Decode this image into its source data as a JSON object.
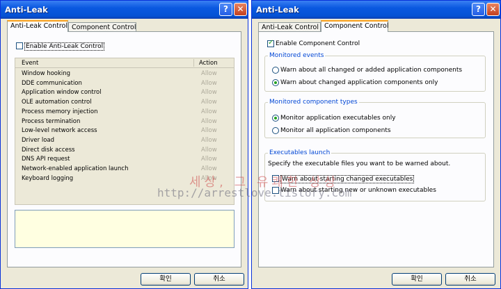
{
  "left_window": {
    "title": "Anti-Leak",
    "tabs": [
      {
        "label": "Anti-Leak Control"
      },
      {
        "label": "Component Control"
      }
    ],
    "enable_label": "Enable Anti-Leak Control",
    "enable_checked": false,
    "table": {
      "headers": {
        "event": "Event",
        "action": "Action"
      },
      "rows": [
        {
          "event": "Window hooking",
          "action": "Allow"
        },
        {
          "event": "DDE communication",
          "action": "Allow"
        },
        {
          "event": "Application window control",
          "action": "Allow"
        },
        {
          "event": "OLE automation control",
          "action": "Allow"
        },
        {
          "event": "Process memory injection",
          "action": "Allow"
        },
        {
          "event": "Process termination",
          "action": "Allow"
        },
        {
          "event": "Low-level network access",
          "action": "Allow"
        },
        {
          "event": "Driver load",
          "action": "Allow"
        },
        {
          "event": "Direct disk access",
          "action": "Allow"
        },
        {
          "event": "DNS API request",
          "action": "Allow"
        },
        {
          "event": "Network-enabled application launch",
          "action": "Allow"
        },
        {
          "event": "Keyboard logging",
          "action": "Allow"
        }
      ]
    },
    "ok_label": "확인",
    "cancel_label": "취소"
  },
  "right_window": {
    "title": "Anti-Leak",
    "tabs": [
      {
        "label": "Anti-Leak Control"
      },
      {
        "label": "Component Control"
      }
    ],
    "enable_label": "Enable Component Control",
    "enable_checked": true,
    "monitored_events": {
      "title": "Monitored events",
      "options": [
        {
          "label": "Warn about all changed or added application components",
          "selected": false
        },
        {
          "label": "Warn about changed application components only",
          "selected": true
        }
      ]
    },
    "monitored_types": {
      "title": "Monitored component types",
      "options": [
        {
          "label": "Monitor application executables only",
          "selected": true
        },
        {
          "label": "Monitor all application components",
          "selected": false
        }
      ]
    },
    "executables_launch": {
      "title": "Executables launch",
      "description": "Specify the executable files you want to be warned about.",
      "options": [
        {
          "label": "Warn about starting changed executables",
          "checked": false
        },
        {
          "label": "Warn about starting new or unknown executables",
          "checked": false
        }
      ]
    },
    "ok_label": "확인",
    "cancel_label": "취소"
  },
  "watermark": {
    "line1": "세상, 그 유쾌한 상상",
    "line2": "http://arrestlove.tistory.com"
  },
  "title_buttons": {
    "help": "?",
    "close": "✕"
  },
  "colors": {
    "accent_tab": "#f9a01a",
    "group_title": "#0046d5",
    "titlebar": "#0a58e0"
  }
}
